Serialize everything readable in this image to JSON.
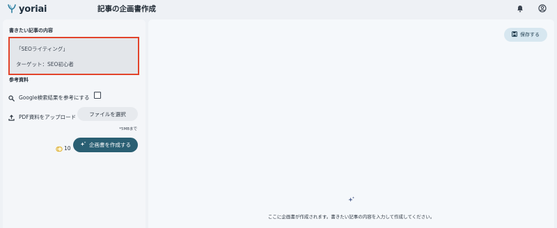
{
  "header": {
    "logo_text": "yoriai",
    "page_title": "記事の企画書作成",
    "bell_icon": "bell-icon",
    "account_icon": "account-circle-icon"
  },
  "left": {
    "content_heading": "書きたい記事の内容",
    "content_lines": [
      "「SEOライティング」",
      "ターゲット：SEO初心者"
    ],
    "reference_heading": "参考資料",
    "google_label": "Google検索結果を参考にする",
    "google_checked": false,
    "pdf_label": "PDF資料をアップロード",
    "file_button": "ファイルを選択",
    "size_note": "*5MBまで",
    "credits": "10",
    "create_button": "企画書を作成する"
  },
  "right": {
    "save_button": "保存する",
    "placeholder": "ここに企画書が作成されます。書きたい記事の内容を入力して作成してください。"
  },
  "colors": {
    "accent": "#2a5f73",
    "highlight_border": "#e2432a",
    "save_bg": "#d7e7f0"
  }
}
